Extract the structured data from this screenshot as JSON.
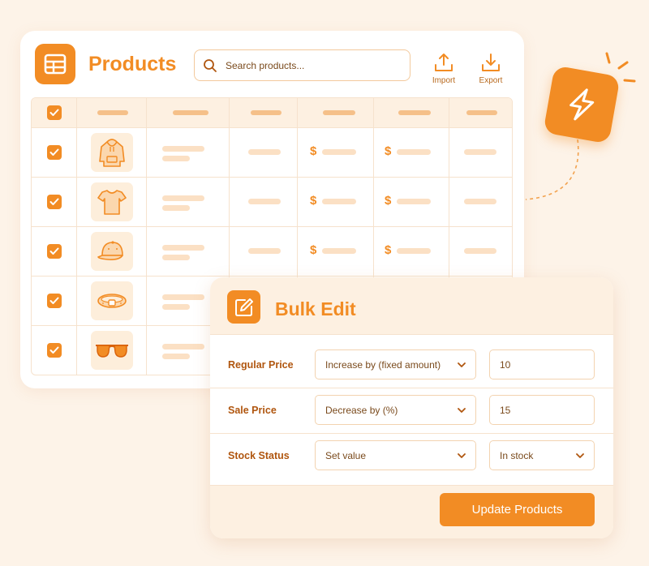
{
  "products": {
    "title": "Products",
    "search_placeholder": "Search products...",
    "import_label": "Import",
    "export_label": "Export",
    "rows": [
      {
        "product": "hoodie",
        "checked": true
      },
      {
        "product": "t-shirt",
        "checked": true
      },
      {
        "product": "cap",
        "checked": true
      },
      {
        "product": "belt",
        "checked": true
      },
      {
        "product": "sunglasses",
        "checked": true
      }
    ],
    "currency_symbol": "$"
  },
  "bulk_edit": {
    "title": "Bulk Edit",
    "fields": [
      {
        "label": "Regular Price",
        "action": "Increase by (fixed amount)",
        "value": "10"
      },
      {
        "label": "Sale Price",
        "action": "Decrease by (%)",
        "value": "15"
      },
      {
        "label": "Stock Status",
        "action": "Set value",
        "value": "In stock"
      }
    ],
    "submit_label": "Update Products"
  },
  "colors": {
    "accent": "#f28c24",
    "background": "#fdf3e8",
    "muted": "#fbe0c4"
  },
  "icons": {
    "header": "table-icon",
    "search": "search-icon",
    "import": "upload-icon",
    "export": "download-icon",
    "bulk": "edit-icon",
    "bolt": "lightning-bolt-icon"
  }
}
